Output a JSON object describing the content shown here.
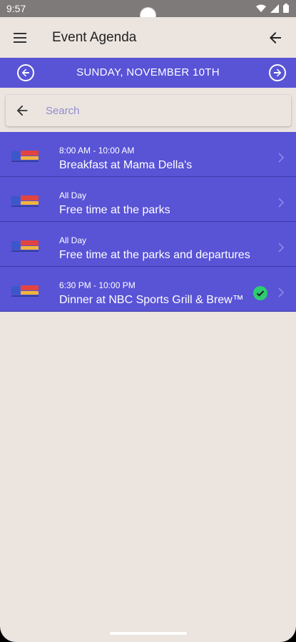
{
  "status_bar": {
    "time": "9:57",
    "icons": [
      "wifi-icon",
      "signal-icon",
      "battery-icon"
    ]
  },
  "app_bar": {
    "title": "Event Agenda",
    "menu_icon": "menu-icon",
    "back_icon": "arrow-back-icon"
  },
  "date_nav": {
    "label": "SUNDAY, NOVEMBER 10TH",
    "prev_icon": "arrow-circle-left-icon",
    "next_icon": "arrow-circle-right-icon"
  },
  "search": {
    "placeholder": "Search",
    "value": ""
  },
  "events": [
    {
      "time": "8:00 AM - 10:00 AM",
      "title": "Breakfast at Mama Della's",
      "checked": false
    },
    {
      "time": "All Day",
      "title": "Free time at the parks",
      "checked": false
    },
    {
      "time": "All Day",
      "title": "Free time at the parks and departures",
      "checked": false
    },
    {
      "time": "6:30 PM - 10:00 PM",
      "title": "Dinner at NBC Sports Grill & Brew™",
      "checked": true
    }
  ],
  "colors": {
    "primary": "#5953d6",
    "background": "#ebe4df",
    "check": "#2ecc71"
  }
}
